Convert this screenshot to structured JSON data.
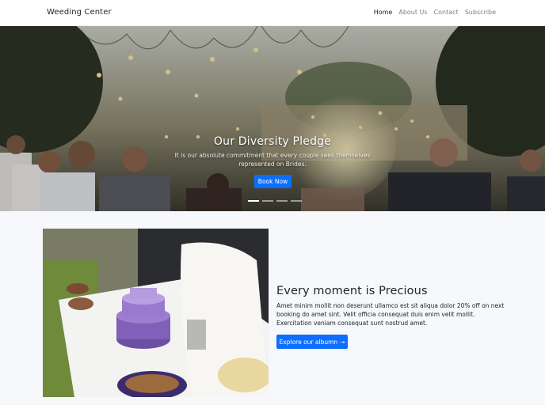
{
  "navbar": {
    "brand": "Weeding Center",
    "links": [
      {
        "label": "Home",
        "active": true
      },
      {
        "label": "About Us",
        "active": false
      },
      {
        "label": "Contact",
        "active": false
      },
      {
        "label": "Subscribe",
        "active": false
      }
    ]
  },
  "hero": {
    "title": "Our Diversity Pledge",
    "subtitle": "It is our absolute commitment that every couple sees themselves represented on Brides.",
    "button_label": "Book Now",
    "slides": 4,
    "active_slide": 1
  },
  "feature": {
    "title": "Every moment is Precious",
    "body": "Amet minim mollit non deserunt ullamco est sit aliqua dolor 20% off on next booking do amet sint. Velit officia consequat duis enim velit mollit. Exercitation veniam consequat sunt nostrud amet.",
    "button_label": "Explore our albumn",
    "button_icon": "arrow-right-icon"
  },
  "colors": {
    "primary": "#0d6efd",
    "background": "#f6f8fb"
  }
}
